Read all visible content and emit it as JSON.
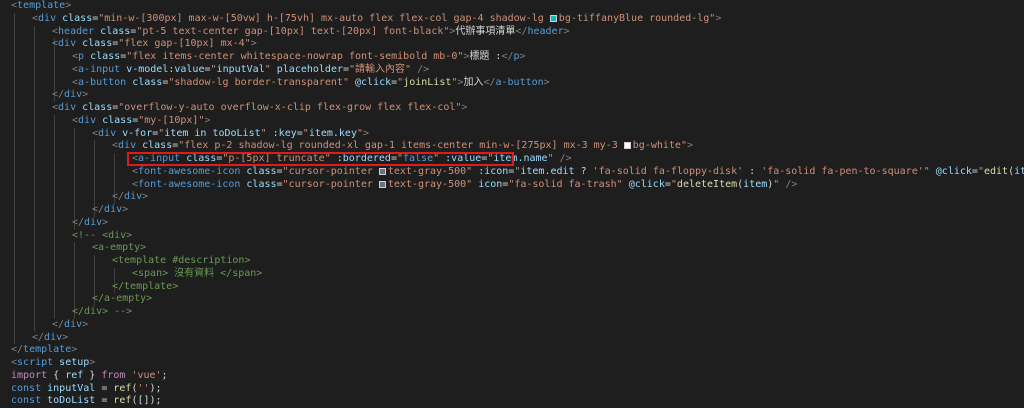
{
  "lines": [
    {
      "indent": 0,
      "parts": [
        {
          "text": "<",
          "c": "ang"
        },
        {
          "text": "template",
          "c": "tag"
        },
        {
          "text": ">",
          "c": "ang"
        }
      ]
    },
    {
      "indent": 1,
      "parts": [
        {
          "text": "<",
          "c": "ang"
        },
        {
          "text": "div",
          "c": "tag"
        },
        {
          "text": " class",
          "c": "attr"
        },
        {
          "text": "=",
          "c": "txt"
        },
        {
          "text": "\"min-w-[300px] max-w-[50vw] h-[75vh] mx-auto flex flex-col gap-4 shadow-lg ",
          "c": "str"
        },
        {
          "swatch": "#0abab5"
        },
        {
          "text": "bg-tiffanyBlue rounded-lg\"",
          "c": "str"
        },
        {
          "text": ">",
          "c": "ang"
        }
      ]
    },
    {
      "indent": 2,
      "parts": [
        {
          "text": "<",
          "c": "ang"
        },
        {
          "text": "header",
          "c": "tag"
        },
        {
          "text": " class",
          "c": "attr"
        },
        {
          "text": "=",
          "c": "txt"
        },
        {
          "text": "\"pt-5 text-center gap-[10px] text-[20px] font-black\"",
          "c": "str"
        },
        {
          "text": ">",
          "c": "ang"
        },
        {
          "text": "代辦事項清單",
          "c": "txt"
        },
        {
          "text": "</",
          "c": "ang"
        },
        {
          "text": "header",
          "c": "tag"
        },
        {
          "text": ">",
          "c": "ang"
        }
      ]
    },
    {
      "indent": 2,
      "parts": [
        {
          "text": "<",
          "c": "ang"
        },
        {
          "text": "div",
          "c": "tag"
        },
        {
          "text": " class",
          "c": "attr"
        },
        {
          "text": "=",
          "c": "txt"
        },
        {
          "text": "\"flex gap-[10px] mx-4\"",
          "c": "str"
        },
        {
          "text": ">",
          "c": "ang"
        }
      ]
    },
    {
      "indent": 3,
      "parts": [
        {
          "text": "<",
          "c": "ang"
        },
        {
          "text": "p",
          "c": "tag"
        },
        {
          "text": " class",
          "c": "attr"
        },
        {
          "text": "=",
          "c": "txt"
        },
        {
          "text": "\"flex items-center whitespace-nowrap font-semibold mb-0\"",
          "c": "str"
        },
        {
          "text": ">",
          "c": "ang"
        },
        {
          "text": "標題 :",
          "c": "txt"
        },
        {
          "text": "</",
          "c": "ang"
        },
        {
          "text": "p",
          "c": "tag"
        },
        {
          "text": ">",
          "c": "ang"
        }
      ]
    },
    {
      "indent": 3,
      "parts": [
        {
          "text": "<",
          "c": "ang"
        },
        {
          "text": "a-input",
          "c": "tag"
        },
        {
          "text": " v-model:value",
          "c": "attr"
        },
        {
          "text": "=",
          "c": "txt"
        },
        {
          "text": "\"",
          "c": "str"
        },
        {
          "text": "inputVal",
          "c": "var"
        },
        {
          "text": "\"",
          "c": "str"
        },
        {
          "text": " placeholder",
          "c": "attr"
        },
        {
          "text": "=",
          "c": "txt"
        },
        {
          "text": "\"請輸入內容\"",
          "c": "str"
        },
        {
          "text": " />",
          "c": "ang"
        }
      ]
    },
    {
      "indent": 3,
      "parts": [
        {
          "text": "<",
          "c": "ang"
        },
        {
          "text": "a-button",
          "c": "tag"
        },
        {
          "text": " class",
          "c": "attr"
        },
        {
          "text": "=",
          "c": "txt"
        },
        {
          "text": "\"shadow-lg border-transparent\"",
          "c": "str"
        },
        {
          "text": " @click",
          "c": "attr"
        },
        {
          "text": "=",
          "c": "txt"
        },
        {
          "text": "\"",
          "c": "str"
        },
        {
          "text": "joinList",
          "c": "fn"
        },
        {
          "text": "\"",
          "c": "str"
        },
        {
          "text": ">",
          "c": "ang"
        },
        {
          "text": "加入",
          "c": "txt"
        },
        {
          "text": "</",
          "c": "ang"
        },
        {
          "text": "a-button",
          "c": "tag"
        },
        {
          "text": ">",
          "c": "ang"
        }
      ]
    },
    {
      "indent": 2,
      "parts": [
        {
          "text": "</",
          "c": "ang"
        },
        {
          "text": "div",
          "c": "tag"
        },
        {
          "text": ">",
          "c": "ang"
        }
      ]
    },
    {
      "indent": 2,
      "parts": [
        {
          "text": "<",
          "c": "ang"
        },
        {
          "text": "div",
          "c": "tag"
        },
        {
          "text": " class",
          "c": "attr"
        },
        {
          "text": "=",
          "c": "txt"
        },
        {
          "text": "\"overflow-y-auto overflow-x-clip flex-grow flex flex-col\"",
          "c": "str"
        },
        {
          "text": ">",
          "c": "ang"
        }
      ]
    },
    {
      "indent": 3,
      "parts": [
        {
          "text": "<",
          "c": "ang"
        },
        {
          "text": "div",
          "c": "tag"
        },
        {
          "text": " class",
          "c": "attr"
        },
        {
          "text": "=",
          "c": "txt"
        },
        {
          "text": "\"my-[10px]\"",
          "c": "str"
        },
        {
          "text": ">",
          "c": "ang"
        }
      ]
    },
    {
      "indent": 4,
      "parts": [
        {
          "text": "<",
          "c": "ang"
        },
        {
          "text": "div",
          "c": "tag"
        },
        {
          "text": " v-for",
          "c": "attr"
        },
        {
          "text": "=",
          "c": "txt"
        },
        {
          "text": "\"",
          "c": "str"
        },
        {
          "text": "item in toDoList",
          "c": "var"
        },
        {
          "text": "\"",
          "c": "str"
        },
        {
          "text": " :key",
          "c": "attr"
        },
        {
          "text": "=",
          "c": "txt"
        },
        {
          "text": "\"",
          "c": "str"
        },
        {
          "text": "item.key",
          "c": "var"
        },
        {
          "text": "\"",
          "c": "str"
        },
        {
          "text": ">",
          "c": "ang"
        }
      ]
    },
    {
      "indent": 5,
      "parts": [
        {
          "text": "<",
          "c": "ang"
        },
        {
          "text": "div",
          "c": "tag"
        },
        {
          "text": " class",
          "c": "attr"
        },
        {
          "text": "=",
          "c": "txt"
        },
        {
          "text": "\"flex p-2 shadow-lg rounded-xl gap-1 items-center min-w-[275px] mx-3 my-3 ",
          "c": "str"
        },
        {
          "swatch": "#ffffff"
        },
        {
          "text": "bg-white\"",
          "c": "str"
        },
        {
          "text": ">",
          "c": "ang"
        }
      ]
    },
    {
      "indent": 6,
      "parts": [
        {
          "text": "<",
          "c": "ang"
        },
        {
          "text": "a-input",
          "c": "tag"
        },
        {
          "text": " class",
          "c": "attr"
        },
        {
          "text": "=",
          "c": "txt"
        },
        {
          "text": "\"p-[5px] truncate\"",
          "c": "str"
        },
        {
          "text": " :bordered",
          "c": "attr"
        },
        {
          "text": "=",
          "c": "txt"
        },
        {
          "text": "\"",
          "c": "str"
        },
        {
          "text": "false",
          "c": "decl"
        },
        {
          "text": "\"",
          "c": "str"
        },
        {
          "text": " :value",
          "c": "attr"
        },
        {
          "text": "=",
          "c": "txt"
        },
        {
          "text": "\"",
          "c": "str"
        },
        {
          "text": "item.name",
          "c": "var"
        },
        {
          "text": "\"",
          "c": "str"
        },
        {
          "text": " />",
          "c": "ang"
        }
      ]
    },
    {
      "indent": 6,
      "parts": [
        {
          "text": "<",
          "c": "ang"
        },
        {
          "text": "font-awesome-icon",
          "c": "tag"
        },
        {
          "text": " class",
          "c": "attr"
        },
        {
          "text": "=",
          "c": "txt"
        },
        {
          "text": "\"cursor-pointer ",
          "c": "str"
        },
        {
          "swatch": "#6b7280"
        },
        {
          "text": "text-gray-500\"",
          "c": "str"
        },
        {
          "text": " :icon",
          "c": "attr"
        },
        {
          "text": "=",
          "c": "txt"
        },
        {
          "text": "\"",
          "c": "str"
        },
        {
          "text": "item.edit",
          "c": "var"
        },
        {
          "text": " ? ",
          "c": "txt"
        },
        {
          "text": "'fa-solid fa-floppy-disk'",
          "c": "str"
        },
        {
          "text": " : ",
          "c": "txt"
        },
        {
          "text": "'fa-solid fa-pen-to-square'\"",
          "c": "str"
        },
        {
          "text": " @click",
          "c": "attr"
        },
        {
          "text": "=",
          "c": "txt"
        },
        {
          "text": "\"",
          "c": "str"
        },
        {
          "text": "edit",
          "c": "fn"
        },
        {
          "text": "(",
          "c": "txt"
        },
        {
          "text": "item",
          "c": "var"
        },
        {
          "text": ")",
          "c": "txt"
        },
        {
          "text": "\"",
          "c": "str"
        },
        {
          "text": " />",
          "c": "ang"
        }
      ]
    },
    {
      "indent": 6,
      "parts": [
        {
          "text": "<",
          "c": "ang"
        },
        {
          "text": "font-awesome-icon",
          "c": "tag"
        },
        {
          "text": " class",
          "c": "attr"
        },
        {
          "text": "=",
          "c": "txt"
        },
        {
          "text": "\"cursor-pointer ",
          "c": "str"
        },
        {
          "swatch": "#6b7280"
        },
        {
          "text": "text-gray-500\"",
          "c": "str"
        },
        {
          "text": " icon",
          "c": "attr"
        },
        {
          "text": "=",
          "c": "txt"
        },
        {
          "text": "\"fa-solid fa-trash\"",
          "c": "str"
        },
        {
          "text": " @click",
          "c": "attr"
        },
        {
          "text": "=",
          "c": "txt"
        },
        {
          "text": "\"",
          "c": "str"
        },
        {
          "text": "deleteItem",
          "c": "fn"
        },
        {
          "text": "(",
          "c": "txt"
        },
        {
          "text": "item",
          "c": "var"
        },
        {
          "text": ")",
          "c": "txt"
        },
        {
          "text": "\"",
          "c": "str"
        },
        {
          "text": " />",
          "c": "ang"
        }
      ]
    },
    {
      "indent": 5,
      "parts": [
        {
          "text": "</",
          "c": "ang"
        },
        {
          "text": "div",
          "c": "tag"
        },
        {
          "text": ">",
          "c": "ang"
        }
      ]
    },
    {
      "indent": 4,
      "parts": [
        {
          "text": "</",
          "c": "ang"
        },
        {
          "text": "div",
          "c": "tag"
        },
        {
          "text": ">",
          "c": "ang"
        }
      ]
    },
    {
      "indent": 3,
      "parts": [
        {
          "text": "</",
          "c": "ang"
        },
        {
          "text": "div",
          "c": "tag"
        },
        {
          "text": ">",
          "c": "ang"
        }
      ]
    },
    {
      "indent": 3,
      "parts": [
        {
          "text": "<!-- <div>",
          "c": "cmt"
        }
      ]
    },
    {
      "indent": 4,
      "parts": [
        {
          "text": "<a-empty>",
          "c": "cmt"
        }
      ]
    },
    {
      "indent": 5,
      "parts": [
        {
          "text": "<template #description>",
          "c": "cmt"
        }
      ]
    },
    {
      "indent": 6,
      "parts": [
        {
          "text": "<span> 沒有資料 </span>",
          "c": "cmt"
        }
      ]
    },
    {
      "indent": 5,
      "parts": [
        {
          "text": "</template>",
          "c": "cmt"
        }
      ]
    },
    {
      "indent": 4,
      "parts": [
        {
          "text": "</a-empty>",
          "c": "cmt"
        }
      ]
    },
    {
      "indent": 3,
      "parts": [
        {
          "text": "</div> -->",
          "c": "cmt"
        }
      ]
    },
    {
      "indent": 2,
      "parts": [
        {
          "text": "</",
          "c": "ang"
        },
        {
          "text": "div",
          "c": "tag"
        },
        {
          "text": ">",
          "c": "ang"
        }
      ]
    },
    {
      "indent": 1,
      "parts": [
        {
          "text": "</",
          "c": "ang"
        },
        {
          "text": "div",
          "c": "tag"
        },
        {
          "text": ">",
          "c": "ang"
        }
      ]
    },
    {
      "indent": 0,
      "parts": [
        {
          "text": "</",
          "c": "ang"
        },
        {
          "text": "template",
          "c": "tag"
        },
        {
          "text": ">",
          "c": "ang"
        }
      ]
    },
    {
      "indent": 0,
      "parts": [
        {
          "text": "<",
          "c": "ang"
        },
        {
          "text": "script",
          "c": "tag"
        },
        {
          "text": " setup",
          "c": "attr"
        },
        {
          "text": ">",
          "c": "ang"
        }
      ]
    },
    {
      "indent": 0,
      "parts": [
        {
          "text": "import",
          "c": "kw"
        },
        {
          "text": " { ",
          "c": "txt"
        },
        {
          "text": "ref",
          "c": "var"
        },
        {
          "text": " } ",
          "c": "txt"
        },
        {
          "text": "from",
          "c": "kw"
        },
        {
          "text": " ",
          "c": "txt"
        },
        {
          "text": "'vue'",
          "c": "str"
        },
        {
          "text": ";",
          "c": "txt"
        }
      ]
    },
    {
      "indent": 0,
      "parts": [
        {
          "text": "const",
          "c": "decl"
        },
        {
          "text": " ",
          "c": "txt"
        },
        {
          "text": "inputVal",
          "c": "var"
        },
        {
          "text": " = ",
          "c": "txt"
        },
        {
          "text": "ref",
          "c": "fn"
        },
        {
          "text": "(",
          "c": "txt"
        },
        {
          "text": "''",
          "c": "str"
        },
        {
          "text": ");",
          "c": "txt"
        }
      ]
    },
    {
      "indent": 0,
      "parts": [
        {
          "text": "const",
          "c": "decl"
        },
        {
          "text": " ",
          "c": "txt"
        },
        {
          "text": "toDoList",
          "c": "var"
        },
        {
          "text": " = ",
          "c": "txt"
        },
        {
          "text": "ref",
          "c": "fn"
        },
        {
          "text": "([]);",
          "c": "txt"
        }
      ]
    }
  ],
  "highlight": {
    "line_index": 12,
    "color": "#e01b1b"
  },
  "colors": {
    "background": "#1e1e1e",
    "tag": "#569cd6",
    "attribute": "#9cdcfe",
    "string": "#ce9178",
    "comment": "#6a9955",
    "keyword": "#c586c0",
    "function": "#dcdcaa"
  }
}
